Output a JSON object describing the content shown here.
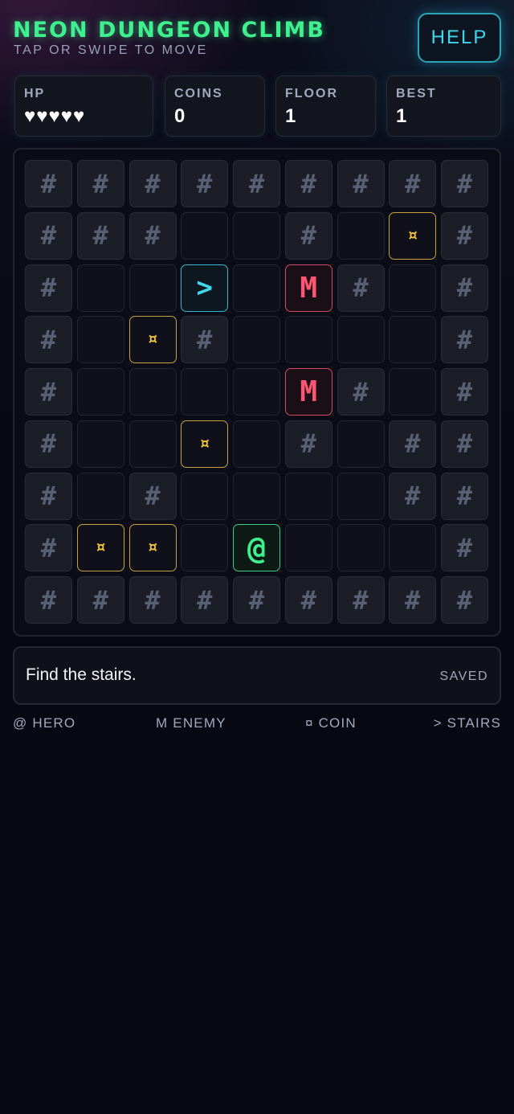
{
  "header": {
    "title": "NEON DUNGEON CLIMB",
    "subtitle": "TAP OR SWIPE TO MOVE",
    "help_label": "HELP"
  },
  "stats": {
    "hp": {
      "label": "HP",
      "value": "♥♥♥♥♥",
      "count": 5
    },
    "coins": {
      "label": "COINS",
      "value": "0"
    },
    "floor": {
      "label": "FLOOR",
      "value": "1"
    },
    "best": {
      "label": "BEST",
      "value": "1"
    }
  },
  "board": {
    "rows": [
      "#########",
      "###..#.¤#",
      "#..>.M#.#",
      "#.¤#....#",
      "#....M#.#",
      "#..¤.#.##",
      "#.#....##",
      "#¤¤.@...#",
      "#########"
    ],
    "glyphs": {
      "wall": "#",
      "coin": "¤",
      "enemy": "M",
      "stairs": ">",
      "hero": "@",
      "floor": ""
    }
  },
  "message": {
    "text": "Find the stairs.",
    "status": "SAVED"
  },
  "legend": [
    "@ HERO",
    "M ENEMY",
    "¤ COIN",
    "> STAIRS"
  ],
  "colors": {
    "title": "#3ef08e",
    "help": "#3fd6ee",
    "coin": "#f2c53a",
    "enemy": "#ff5573",
    "stairs": "#3fd6ee",
    "hero": "#3ef08e",
    "wall": "#5a6074"
  }
}
